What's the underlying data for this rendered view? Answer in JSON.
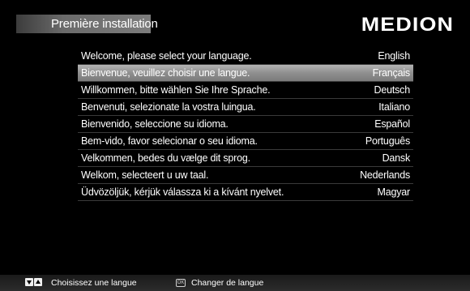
{
  "header": {
    "title": "Première installation",
    "brand": "MEDION"
  },
  "languages": [
    {
      "prompt": "Welcome, please select your language.",
      "name": "English"
    },
    {
      "prompt": "Bienvenue, veuillez choisir une langue.",
      "name": "Français",
      "selected": true
    },
    {
      "prompt": "Willkommen, bitte wählen Sie Ihre Sprache.",
      "name": "Deutsch"
    },
    {
      "prompt": "Benvenuti, selezionate la vostra luingua.",
      "name": "Italiano"
    },
    {
      "prompt": "Bienvenido, seleccione su idioma.",
      "name": "Español"
    },
    {
      "prompt": "Bem-vido, favor selecionar o seu idioma.",
      "name": "Português"
    },
    {
      "prompt": "Velkommen, bedes du vælge dit sprog.",
      "name": "Dansk"
    },
    {
      "prompt": "Welkom, selecteert u uw taal.",
      "name": "Nederlands"
    },
    {
      "prompt": "Üdvözöljük, kérjük válassza ki a kívánt nyelvet.",
      "name": "Magyar"
    }
  ],
  "footer": {
    "nav_icon": "up-down-arrow-keys-icon",
    "nav_hint": "Choisissez une langue",
    "ok_icon": "ok-key-icon",
    "ok_label": "OK",
    "ok_hint": "Changer de langue"
  },
  "colors": {
    "background": "#000000",
    "selected_row": "#9a9a9a",
    "text": "#ffffff"
  }
}
